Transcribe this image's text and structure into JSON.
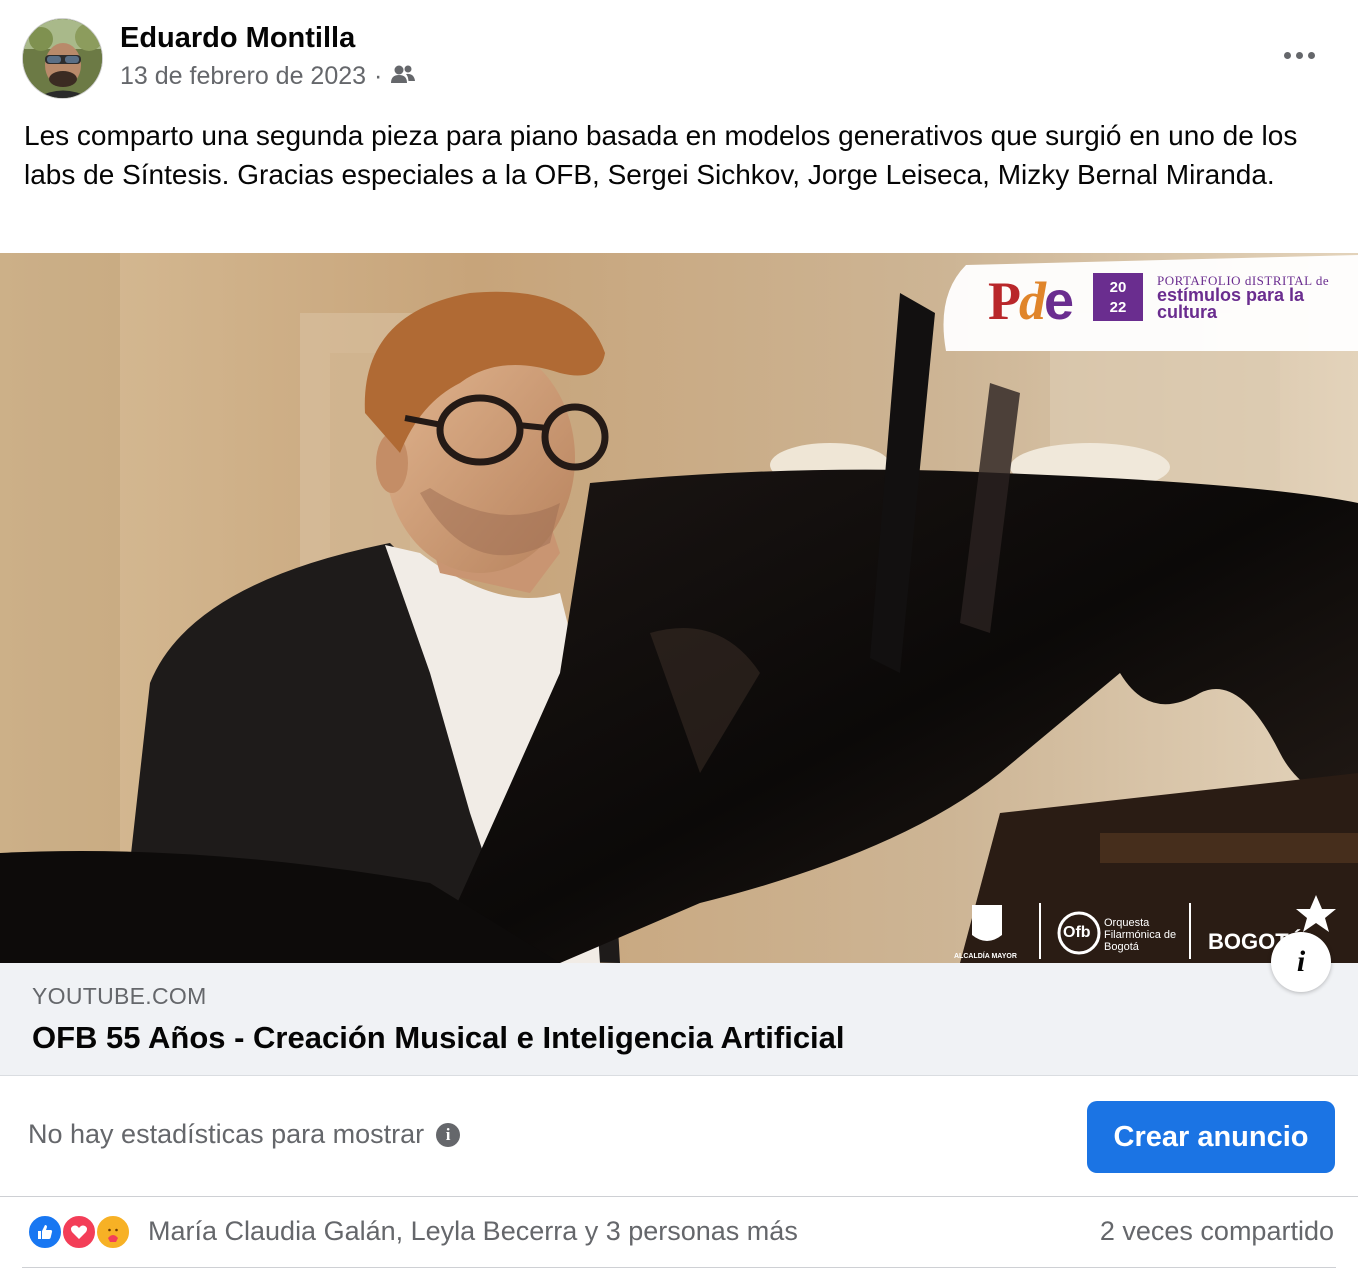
{
  "post": {
    "author": "Eduardo Montilla",
    "date": "13 de febrero de 2023",
    "separator": "·",
    "audience_icon": "friends-icon",
    "text": "Les comparto una segunda pieza para piano basada en modelos generativos que surgió en uno de los labs de Síntesis. Gracias especiales a la OFB, Sergei Sichkov, Jorge Leiseca, Mizky Bernal Miranda."
  },
  "media": {
    "overlay_logo": {
      "pde_p": "P",
      "pde_d": "d",
      "pde_e": "e",
      "year_top": "20",
      "year_bottom": "22",
      "small_text": "PORTAFOLIO dISTRITAL de",
      "big_text": "estímulos para la cultura"
    },
    "footer_logos": {
      "alcaldia": "ALCALDÍA MAYOR",
      "ofb_mark": "Ofb",
      "ofb_name": "Orquesta Filarmónica de Bogotá",
      "bogota": "BOGOTÁ"
    },
    "info_button": "i"
  },
  "link": {
    "domain": "YOUTUBE.COM",
    "title": "OFB 55 Años - Creación Musical e Inteligencia Artificial"
  },
  "insights": {
    "text": "No hay estadísticas para mostrar",
    "info_glyph": "i",
    "boost_label": "Crear anuncio"
  },
  "reactions": {
    "icons": [
      "like-icon",
      "love-icon",
      "care-icon"
    ],
    "names": "María Claudia Galán, Leyla Becerra y 3 personas más",
    "shares": "2 veces compartido"
  },
  "colors": {
    "accent": "#1b74e4",
    "secondary_text": "#65676b",
    "like": "#1877f2",
    "love": "#f33e58",
    "care": "#f7b125"
  }
}
